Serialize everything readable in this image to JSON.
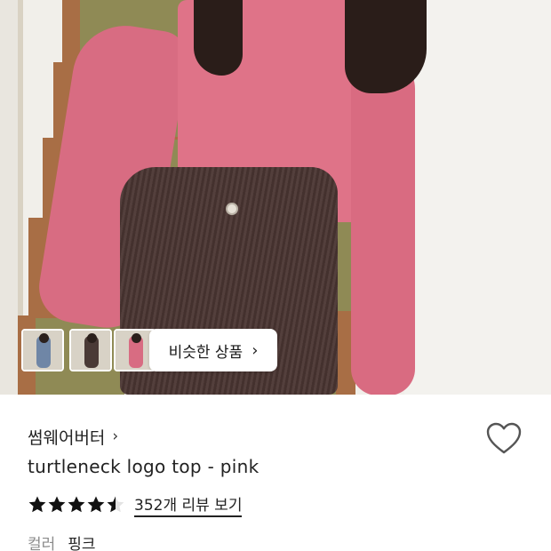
{
  "gallery": {
    "thumbnails": [
      {
        "icon": "thumbnail-photo-1",
        "outfit_color": "#6f86a6"
      },
      {
        "icon": "thumbnail-photo-2",
        "outfit_color": "#4a3a36"
      },
      {
        "icon": "thumbnail-photo-3",
        "outfit_color": "#d86c82"
      }
    ],
    "similar_button_label": "비슷한 상품",
    "similar_button_icon": "chevron-right-icon"
  },
  "product": {
    "brand": "썸웨어버터",
    "brand_icon": "chevron-right-icon",
    "name": "turtleneck logo top - pink",
    "wishlist_icon": "heart-outline-icon",
    "rating": 4.5,
    "rating_max": 5,
    "review_link": "352개 리뷰 보기",
    "color_label": "컬러",
    "color_value": "핑크"
  },
  "colors": {
    "text": "#222222",
    "muted": "#8b8b8b",
    "star": "#111111",
    "top_pink": "#df7388"
  }
}
